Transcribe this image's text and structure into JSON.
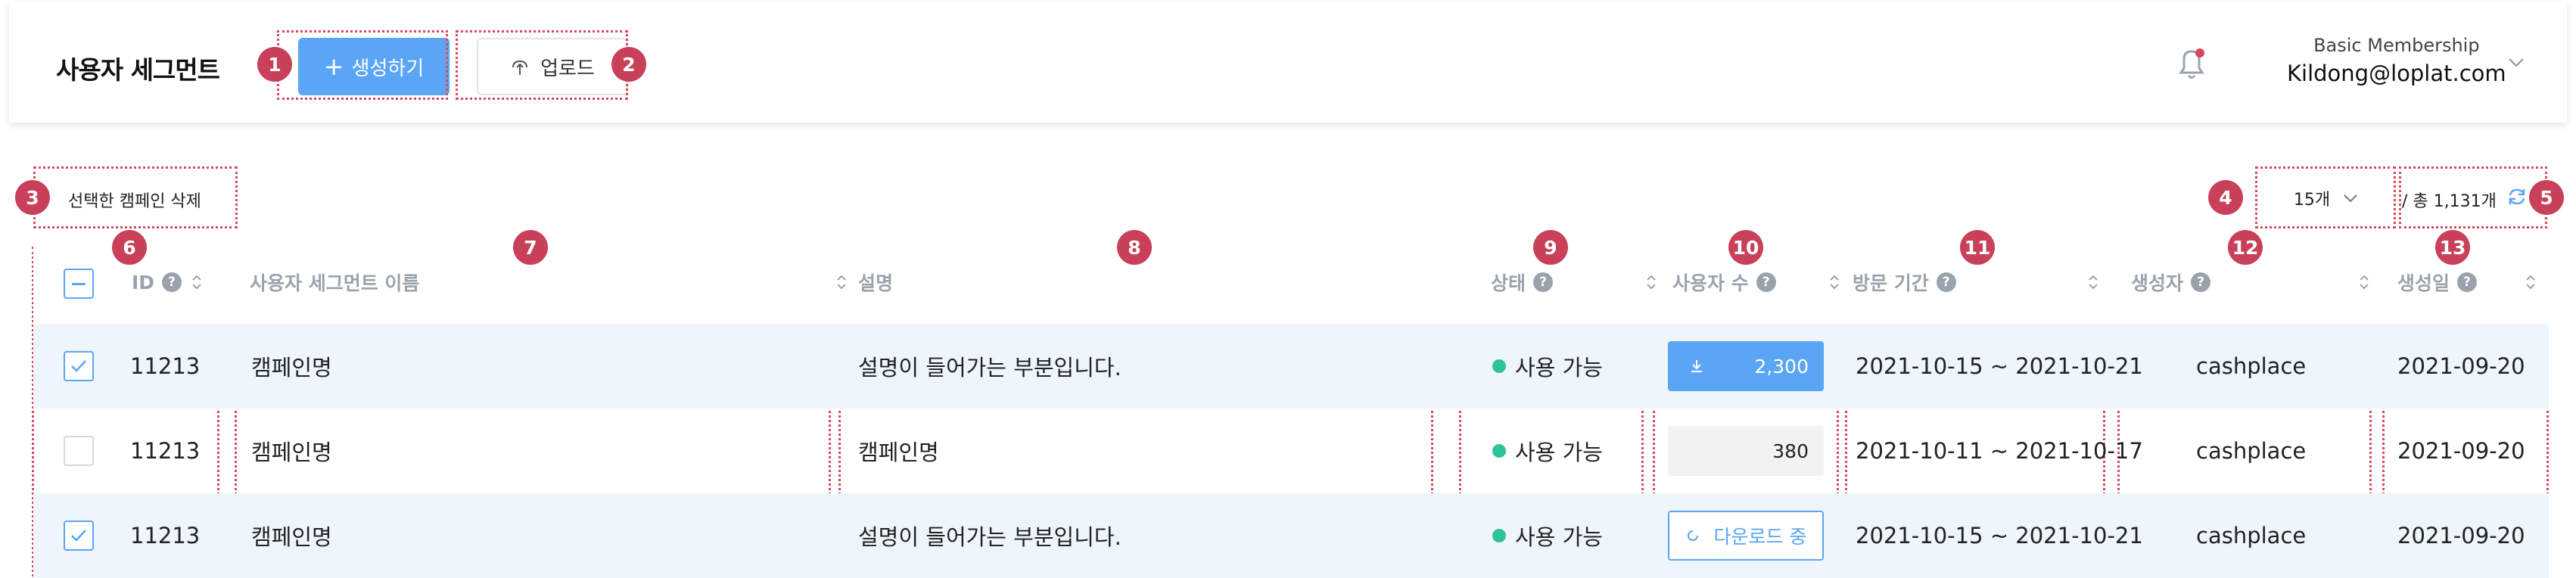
{
  "header": {
    "title": "사용자 세그먼트",
    "create_label": "생성하기",
    "upload_label": "업로드",
    "account": {
      "tier": "Basic Membership",
      "email": "Kildong@loplat.com"
    }
  },
  "toolbar": {
    "delete_label": "선택한 캠페인 삭제",
    "page_size": "15개",
    "total": "/ 총 1,131개"
  },
  "markers": [
    "1",
    "2",
    "3",
    "4",
    "5",
    "6",
    "7",
    "8",
    "9",
    "10",
    "11",
    "12",
    "13"
  ],
  "columns": {
    "id": "ID",
    "name": "사용자 세그먼트 이름",
    "desc": "설명",
    "status": "상태",
    "users": "사용자 수",
    "period": "방문 기간",
    "creator": "생성자",
    "created": "생성일"
  },
  "rows": [
    {
      "checked": true,
      "id": "11213",
      "name": "캠페인명",
      "desc": "설명이 들어가는 부분입니다.",
      "status": "사용 가능",
      "users": "2,300",
      "users_state": "download",
      "period": "2021-10-15 ~ 2021-10-21",
      "creator": "cashplace",
      "created": "2021-09-20"
    },
    {
      "checked": false,
      "id": "11213",
      "name": "캠페인명",
      "desc": "캠페인명",
      "status": "사용 가능",
      "users": "380",
      "users_state": "plain",
      "period": "2021-10-11 ~ 2021-10-17",
      "creator": "cashplace",
      "created": "2021-09-20"
    },
    {
      "checked": true,
      "id": "11213",
      "name": "캠페인명",
      "desc": "설명이 들어가는 부분입니다.",
      "status": "사용 가능",
      "users": "다운로드 중",
      "users_state": "downloading",
      "period": "2021-10-15 ~ 2021-10-21",
      "creator": "cashplace",
      "created": "2021-09-20"
    }
  ],
  "colors": {
    "accent": "#5aa6f5",
    "marker": "#c9405a",
    "status_ok": "#2fc39a",
    "row_alt": "#eef5fd"
  },
  "icons": [
    "plus-icon",
    "upload-icon",
    "bell-icon",
    "chevron-down-icon",
    "refresh-icon",
    "help-icon",
    "sort-icon",
    "download-icon",
    "loading-icon"
  ]
}
